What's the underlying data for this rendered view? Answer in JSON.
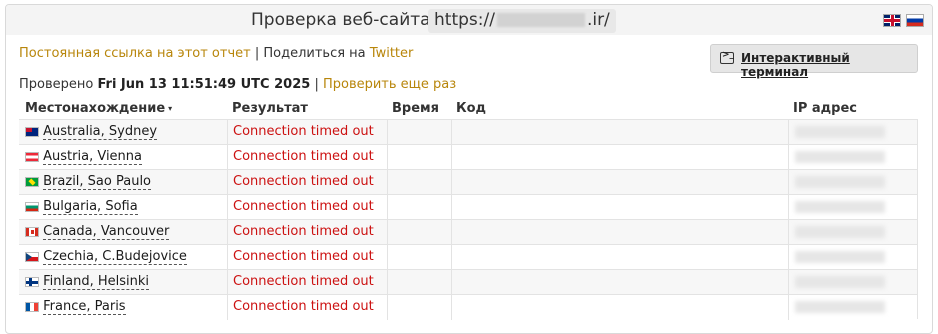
{
  "header": {
    "title": "Проверка веб-сайта",
    "url_prefix": "https://",
    "url_suffix": ".ir/"
  },
  "links": {
    "permalink": "Постоянная ссылка на этот отчет",
    "separator": "|",
    "share_text": "Поделиться на",
    "twitter": "Twitter"
  },
  "terminal_button": {
    "label": "Интерактивный терминал",
    "icon": "terminal-icon"
  },
  "checked": {
    "label": "Проверено",
    "datetime": "Fri Jun 13 11:51:49 UTC 2025",
    "separator": "|",
    "recheck": "Проверить еще раз"
  },
  "table": {
    "headers": {
      "location": "Местонахождение",
      "sort_icon": "▾",
      "result": "Результат",
      "time": "Время",
      "code": "Код",
      "ip": "IP адрес"
    },
    "rows": [
      {
        "flag": "au",
        "location": "Australia, Sydney",
        "result": "Connection timed out"
      },
      {
        "flag": "at",
        "location": "Austria, Vienna",
        "result": "Connection timed out"
      },
      {
        "flag": "br",
        "location": "Brazil, Sao Paulo",
        "result": "Connection timed out"
      },
      {
        "flag": "bg",
        "location": "Bulgaria, Sofia",
        "result": "Connection timed out"
      },
      {
        "flag": "ca",
        "location": "Canada, Vancouver",
        "result": "Connection timed out"
      },
      {
        "flag": "cz",
        "location": "Czechia, C.Budejovice",
        "result": "Connection timed out"
      },
      {
        "flag": "fi",
        "location": "Finland, Helsinki",
        "result": "Connection timed out"
      },
      {
        "flag": "fr",
        "location": "France, Paris",
        "result": "Connection timed out"
      }
    ]
  },
  "colors": {
    "link": "#b8860b",
    "error": "#cc1111",
    "header_bg": "#f4f4f4"
  }
}
